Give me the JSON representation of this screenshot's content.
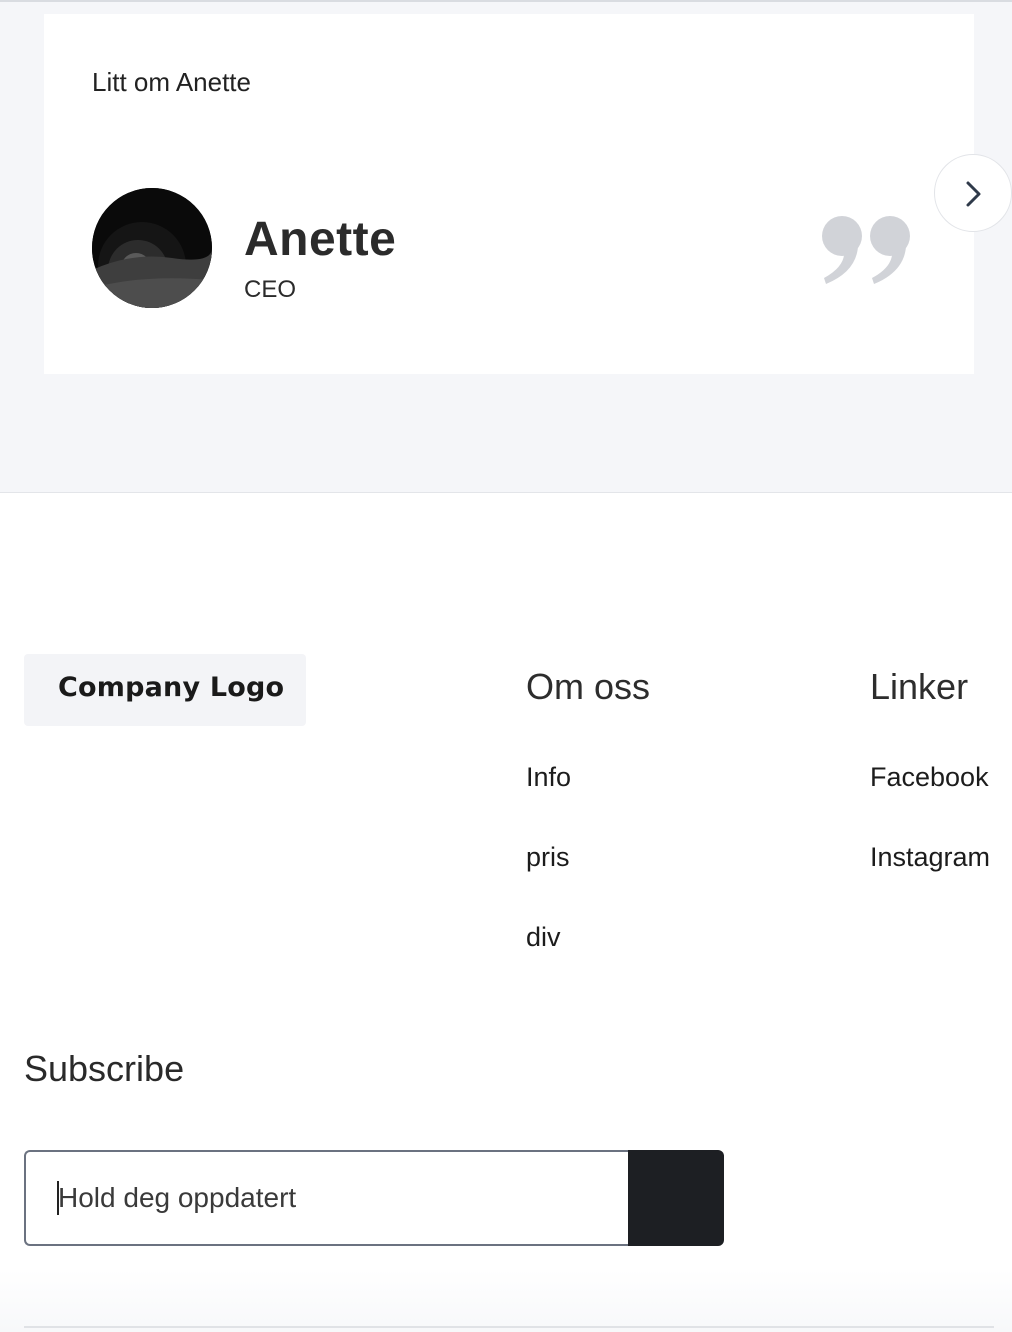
{
  "testimonial": {
    "heading": "Litt om Anette",
    "name": "Anette",
    "role": "CEO",
    "quote_icon": "quote-mark-icon",
    "next_icon": "chevron-right-icon"
  },
  "footer": {
    "logo": "Company Logo",
    "columns": [
      {
        "heading": "Om oss",
        "links": [
          "Info",
          "pris",
          "div"
        ]
      },
      {
        "heading": "Linker",
        "links": [
          "Facebook",
          "Instagram"
        ]
      }
    ],
    "subscribe": {
      "title": "Subscribe",
      "placeholder": "Hold deg oppdatert"
    }
  },
  "colors": {
    "band_background": "#f5f6f9",
    "button_dark": "#1d1f23",
    "quote_gray": "#d1d3d8"
  }
}
